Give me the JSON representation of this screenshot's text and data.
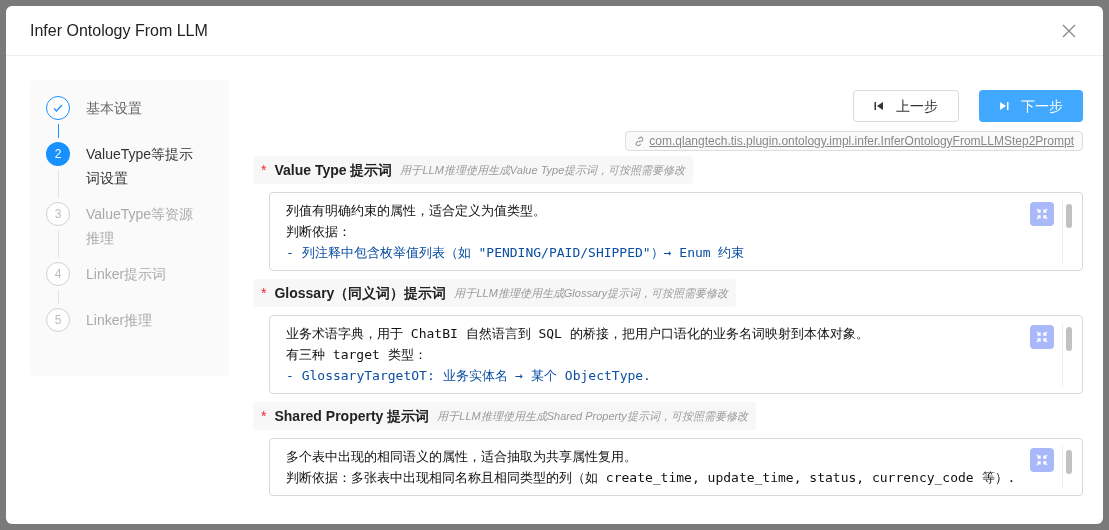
{
  "dialog": {
    "title": "Infer Ontology From LLM"
  },
  "steps": [
    {
      "label": "基本设置",
      "done": true,
      "selected": false
    },
    {
      "number": "2",
      "label": "ValueType等提示词设置",
      "done": false,
      "selected": true
    },
    {
      "number": "3",
      "label": "ValueType等资源推理",
      "done": false,
      "selected": false
    },
    {
      "number": "4",
      "label": "Linker提示词",
      "done": false,
      "selected": false
    },
    {
      "number": "5",
      "label": "Linker推理",
      "done": false,
      "selected": false
    }
  ],
  "buttons": [
    {
      "label": "上一步",
      "kind": "prev"
    },
    {
      "label": "下一步",
      "kind": "next"
    }
  ],
  "plugin_link": "com.qlangtech.tis.plugin.ontology.impl.infer.InferOntologyFromLLMStep2Prompt",
  "fields": [
    {
      "label": "Value Type 提示词",
      "required_mark": "*",
      "hint": "用于LLM推理使用生成Value Type提示词，可按照需要修改",
      "lines": [
        {
          "text": "列值有明确约束的属性，适合定义为值类型。",
          "kind": "text"
        },
        {
          "text": "判断依据：",
          "kind": "text"
        },
        {
          "text": "- 列注释中包含枚举值列表（如 \"PENDING/PAID/SHIPPED\"）→ Enum 约束",
          "kind": "list"
        }
      ]
    },
    {
      "label": "Glossary（同义词）提示词",
      "required_mark": "*",
      "hint": "用于LLM推理使用生成Glossary提示词，可按照需要修改",
      "lines": [
        {
          "text": "业务术语字典，用于 ChatBI 自然语言到 SQL 的桥接，把用户口语化的业务名词映射到本体对象。",
          "kind": "text"
        },
        {
          "text": "有三种 target 类型：",
          "kind": "text"
        },
        {
          "text": "- GlossaryTargetOT: 业务实体名 → 某个 ObjectType.",
          "kind": "list"
        }
      ]
    },
    {
      "label": "Shared Property 提示词",
      "required_mark": "*",
      "hint": "用于LLM推理使用生成Shared Property提示词，可按照需要修改",
      "lines": [
        {
          "text": "多个表中出现的相同语义的属性，适合抽取为共享属性复用。",
          "kind": "text"
        },
        {
          "text": "判断依据：多张表中出现相同名称且相同类型的列（如 create_time, update_time, status, currency_code 等）.",
          "kind": "text"
        }
      ]
    }
  ]
}
